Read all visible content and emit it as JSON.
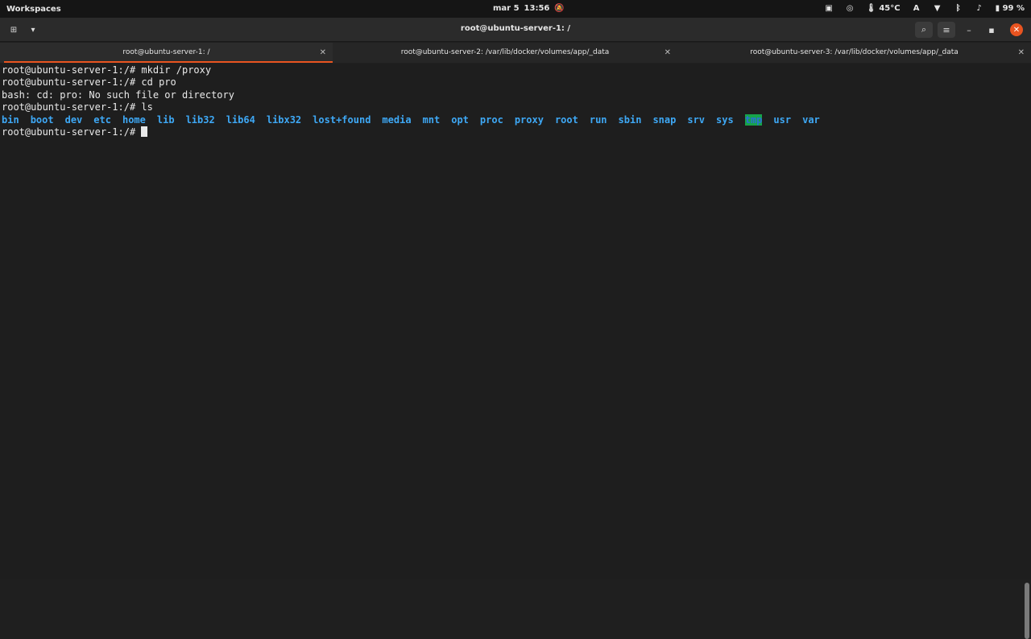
{
  "topbar": {
    "workspaces": "Workspaces",
    "date": "mar 5",
    "time": "13:56",
    "temperature": "45°C",
    "battery": "99 %",
    "icons": [
      "notifications-off-icon",
      "screen-icon",
      "chrome-icon",
      "thermometer-icon",
      "text-icon",
      "wifi-icon",
      "bluetooth-icon",
      "volume-icon",
      "battery-icon"
    ]
  },
  "window": {
    "title": "root@ubuntu-server-1: /",
    "buttons": [
      "search-icon",
      "menu-icon",
      "minimize-icon",
      "maximize-icon",
      "close-icon"
    ]
  },
  "tabs": [
    {
      "label": "root@ubuntu-server-1: /",
      "active": true
    },
    {
      "label": "root@ubuntu-server-2: /var/lib/docker/volumes/app/_data",
      "active": false
    },
    {
      "label": "root@ubuntu-server-3: /var/lib/docker/volumes/app/_data",
      "active": false
    }
  ],
  "terminal": {
    "lines": [
      "root@ubuntu-server-1:/# mkdir /proxy",
      "root@ubuntu-server-1:/# cd pro",
      "bash: cd: pro: No such file or directory",
      "root@ubuntu-server-1:/# ls"
    ],
    "prompt": "root@ubuntu-server-1:/# ",
    "ls_output": [
      "bin",
      "boot",
      "dev",
      "etc",
      "home",
      "lib",
      "lib32",
      "lib64",
      "libx32",
      "lost+found",
      "media",
      "mnt",
      "opt",
      "proc",
      "proxy",
      "root",
      "run",
      "sbin",
      "snap",
      "srv",
      "sys",
      "tmp",
      "usr",
      "var"
    ],
    "highlighted": "tmp"
  },
  "colors": {
    "accent": "#e95420",
    "dir": "#3ea8f5",
    "tmp_bg": "#16a34a"
  }
}
